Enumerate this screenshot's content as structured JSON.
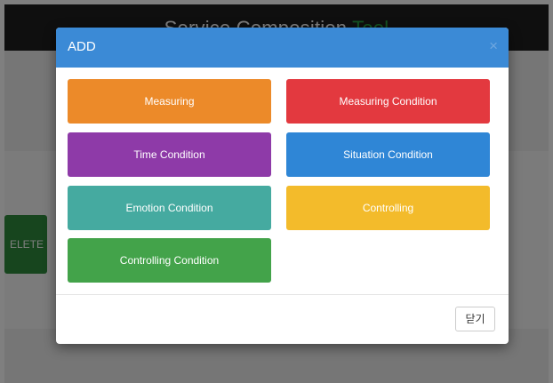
{
  "app": {
    "title_main": "Service Composition ",
    "title_accent": "Tool",
    "delete_label": "ELETE"
  },
  "modal": {
    "title": "ADD",
    "close_icon": "×",
    "footer_close_label": "닫기"
  },
  "options": [
    {
      "label": "Measuring",
      "color": "#ec8a29"
    },
    {
      "label": "Measuring Condition",
      "color": "#e3393f"
    },
    {
      "label": "Time Condition",
      "color": "#8e3aa8"
    },
    {
      "label": "Situation Condition",
      "color": "#2f86d6"
    },
    {
      "label": "Emotion Condition",
      "color": "#45aaa0"
    },
    {
      "label": "Controlling",
      "color": "#f3bb2b"
    },
    {
      "label": "Controlling Condition",
      "color": "#43a34a"
    }
  ],
  "colors": {
    "header_bg": "#3b8ad6",
    "app_header_bg": "#1e1e1e",
    "accent_green": "#28a745"
  }
}
